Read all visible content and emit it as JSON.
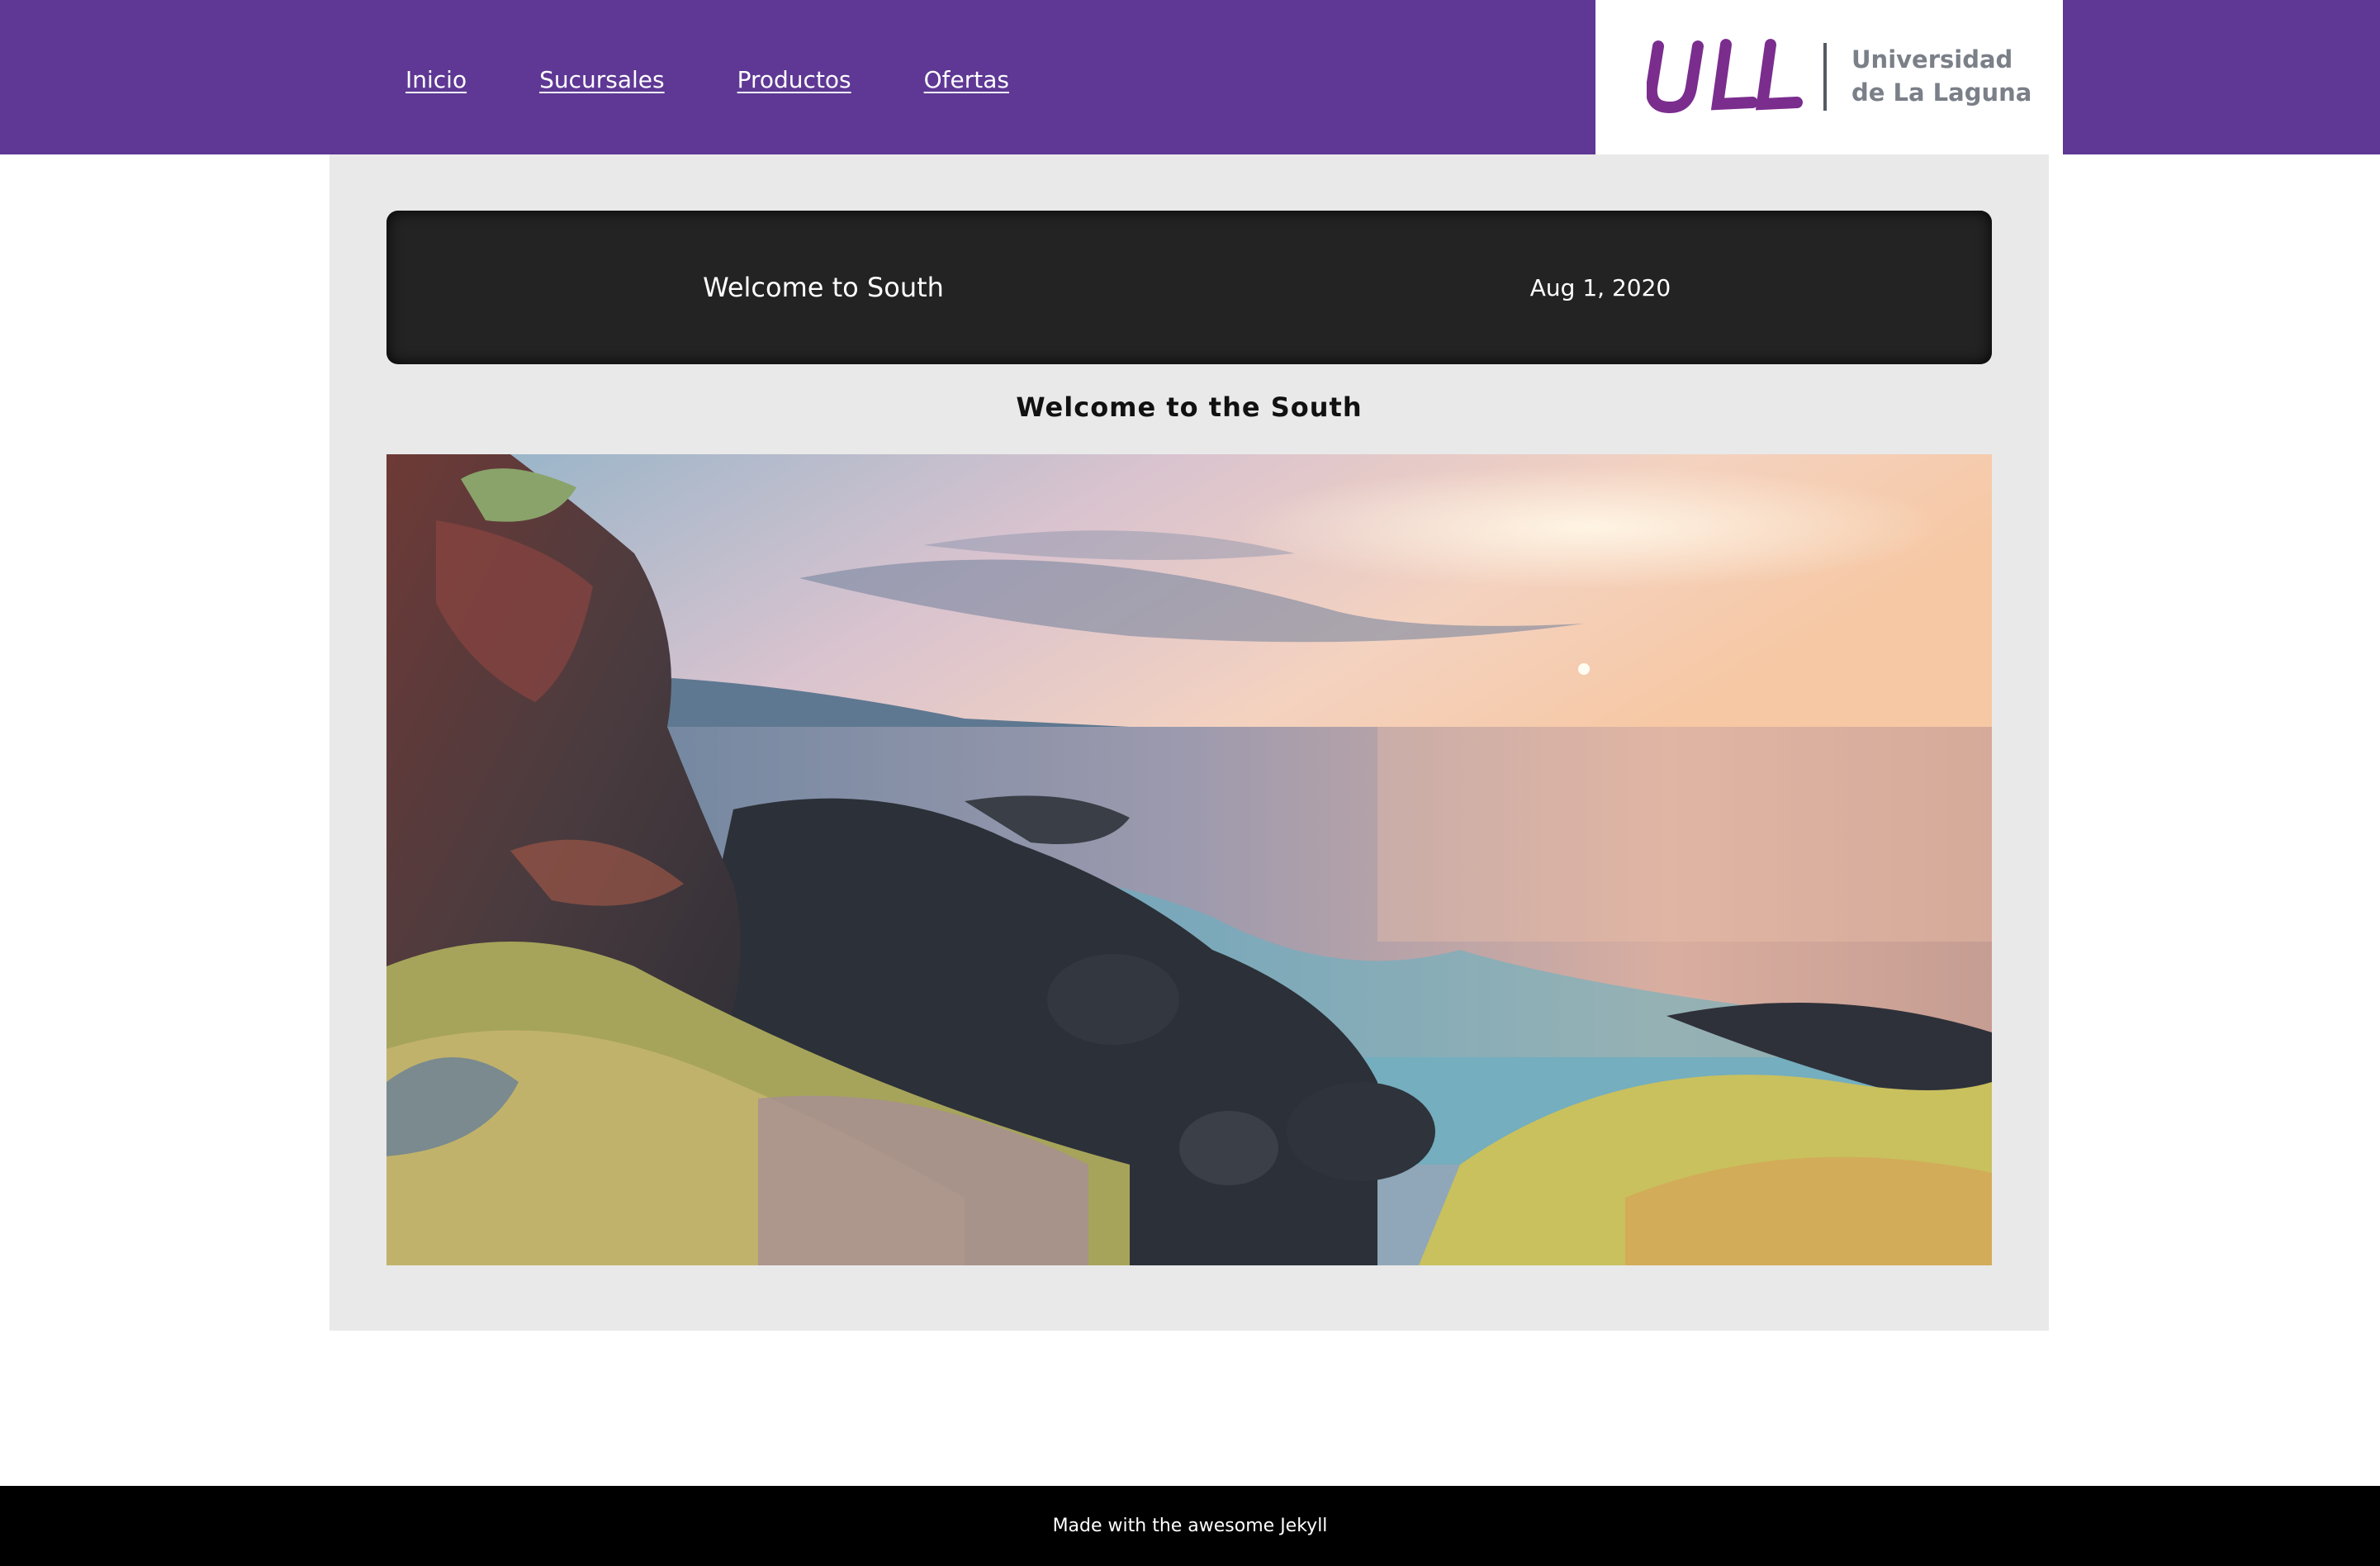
{
  "nav": {
    "items": [
      {
        "label": "Inicio"
      },
      {
        "label": "Sucursales"
      },
      {
        "label": "Productos"
      },
      {
        "label": "Ofertas"
      }
    ]
  },
  "logo": {
    "mark": "ULL",
    "line1": "Universidad",
    "line2": "de La Laguna",
    "mark_color": "#7b2d8e"
  },
  "post": {
    "bar_title": "Welcome to South",
    "date": "Aug 1, 2020",
    "heading": "Welcome to the South"
  },
  "footer": {
    "text": "Made with the awesome Jekyll"
  },
  "colors": {
    "header_bg": "#5e3894",
    "content_bg": "#e9e9e9",
    "post_bar_bg": "#232323",
    "footer_bg": "#000000"
  }
}
